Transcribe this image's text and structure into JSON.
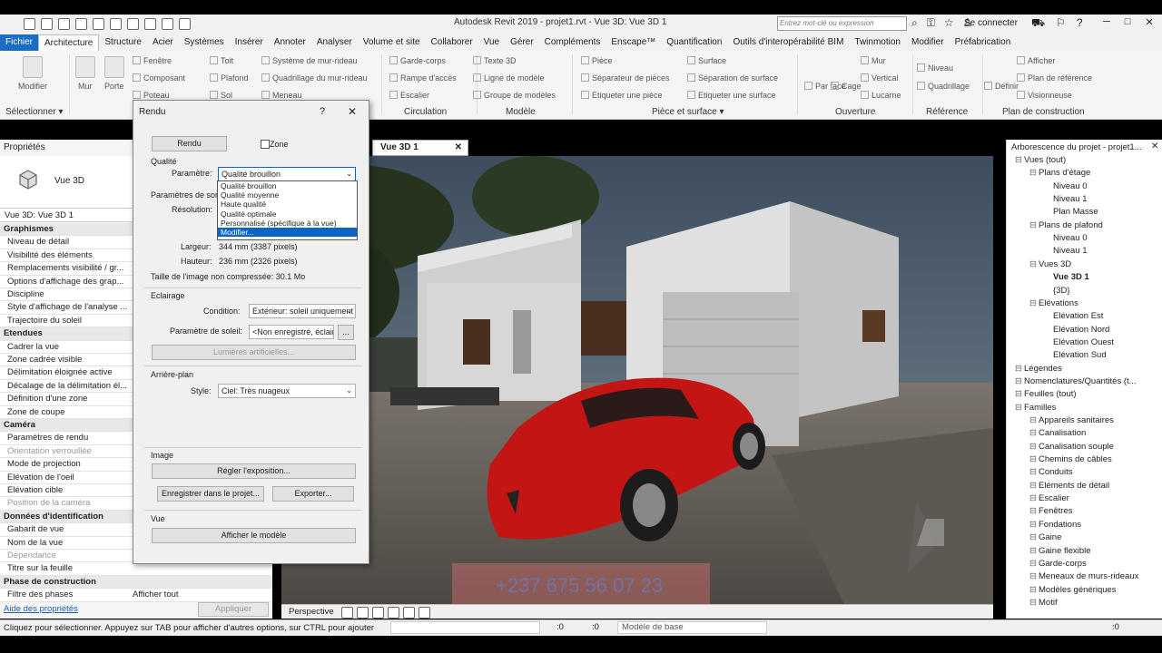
{
  "app": {
    "title": "Autodesk Revit 2019 - projet1.rvt - Vue 3D: Vue 3D 1",
    "search_placeholder": "Entrez mot-clé ou expression",
    "signin": "Se connecter",
    "logo": "R"
  },
  "menu": [
    "Fichier",
    "Architecture",
    "Structure",
    "Acier",
    "Systèmes",
    "Insérer",
    "Annoter",
    "Analyser",
    "Volume et site",
    "Collaborer",
    "Vue",
    "Gérer",
    "Compléments",
    "Enscape™",
    "Quantification",
    "Outils d'interopérabilité BIM",
    "Twinmotion",
    "Modifier",
    "Préfabrication"
  ],
  "ribbon": {
    "modify": "Modifier",
    "select": "Sélectionner",
    "mur": "Mur",
    "porte": "Porte",
    "build_small": [
      "Fenêtre",
      "Composant",
      "Poteau",
      "Toit",
      "Plafond",
      "Sol",
      "Système de mur-rideau",
      "Quadrillage du mur-rideau",
      "Meneau"
    ],
    "circ_small": [
      "Garde-corps",
      "Rampe d'accès",
      "Escalier"
    ],
    "circ_title": "Circulation",
    "model_small": [
      "Texte 3D",
      "Ligne de modèle",
      "Groupe de modèles"
    ],
    "model_title": "Modèle",
    "room_small": [
      "Pièce",
      "Séparateur de pièces",
      "Etiqueter une pièce",
      "Surface",
      "Séparation de surface",
      "Etiqueter une surface"
    ],
    "room_title": "Pièce et surface",
    "open_items": [
      "Par face",
      "Cage",
      "Mur",
      "Vertical",
      "Lucarne"
    ],
    "open_title": "Ouverture",
    "ref_items": [
      "Niveau",
      "Quadrillage"
    ],
    "ref_title": "Référence",
    "wp_items": [
      "Définir",
      "Afficher",
      "Plan de référence",
      "Visionneuse"
    ],
    "wp_title": "Plan de construction"
  },
  "properties": {
    "header": "Propriétés",
    "type": "Vue 3D",
    "instance": "Vue 3D: Vue 3D 1",
    "rows": [
      {
        "k": "Graphismes",
        "sec": true
      },
      {
        "k": "Niveau de détail"
      },
      {
        "k": "Visibilité des éléments"
      },
      {
        "k": "Remplacements visibilité / gr..."
      },
      {
        "k": "Options d'affichage des grap..."
      },
      {
        "k": "Discipline"
      },
      {
        "k": "Style d'affichage de l'analyse ..."
      },
      {
        "k": "Trajectoire du soleil"
      },
      {
        "k": "Etendues",
        "sec": true
      },
      {
        "k": "Cadrer la vue"
      },
      {
        "k": "Zone cadrée visible"
      },
      {
        "k": "Délimitation éloignée active"
      },
      {
        "k": "Décalage de la délimitation él..."
      },
      {
        "k": "Définition d'une zone"
      },
      {
        "k": "Zone de coupe"
      },
      {
        "k": "Caméra",
        "sec": true
      },
      {
        "k": "Paramètres de rendu"
      },
      {
        "k": "Orientation verrouillée",
        "dis": true
      },
      {
        "k": "Mode de projection"
      },
      {
        "k": "Elévation de l'oeil"
      },
      {
        "k": "Elévation cible"
      },
      {
        "k": "Position de la caméra",
        "dis": true
      },
      {
        "k": "Données d'identification",
        "sec": true
      },
      {
        "k": "Gabarit de vue"
      },
      {
        "k": "Nom de la vue"
      },
      {
        "k": "Dépendance",
        "dis": true
      },
      {
        "k": "Titre sur la feuille"
      },
      {
        "k": "Phase de construction",
        "sec": true
      },
      {
        "k": "Filtre des phases",
        "v": "Afficher tout"
      }
    ],
    "help": "Aide des propriétés",
    "apply": "Appliquer"
  },
  "dialog": {
    "title": "Rendu",
    "help": "?",
    "close": "✕",
    "render_btn": "Rendu",
    "zone": "Zone",
    "quality": "Qualité",
    "param": "Paramètre:",
    "param_value": "Qualité brouillon",
    "dropdown": [
      "Qualité brouillon",
      "Qualité moyenne",
      "Haute qualité",
      "Qualité optimale",
      "Personnalisé (spécifique à la vue)",
      "Modifier..."
    ],
    "output": "Paramètres de sortie",
    "resolution": "Résolution:",
    "width_lbl": "Largeur:",
    "width": "344 mm (3387 pixels)",
    "height_lbl": "Hauteur:",
    "height": "236 mm (2326 pixels)",
    "size": "Taille de l'image non compressée: 30.1 Mo",
    "lighting": "Eclairage",
    "condition_lbl": "Condition:",
    "condition": "Extérieur: soleil uniquement",
    "sun_lbl": "Paramètre de soleil:",
    "sun": "<Non enregistré, éclairage>",
    "sun_btn": "...",
    "artificial": "Lumières artificielles...",
    "bg": "Arrière-plan",
    "style_lbl": "Style:",
    "style": "Ciel: Très nuageux",
    "image": "Image",
    "exposure": "Régler l'exposition...",
    "save": "Enregistrer dans le projet...",
    "export": "Exporter...",
    "view": "Vue",
    "show_model": "Afficher le modèle"
  },
  "view": {
    "tab": "Vue 3D 1",
    "close": "✕",
    "projection": "Perspective",
    "watermark": "+237 675 56 07 23"
  },
  "tree": {
    "header": "Arborescence du projet - projet1...",
    "items": [
      {
        "t": "Vues (tout)",
        "l": 0
      },
      {
        "t": "Plans d'étage",
        "l": 1
      },
      {
        "t": "Niveau 0",
        "l": 2
      },
      {
        "t": "Niveau 1",
        "l": 2
      },
      {
        "t": "Plan Masse",
        "l": 2
      },
      {
        "t": "Plans de plafond",
        "l": 1
      },
      {
        "t": "Niveau 0",
        "l": 2
      },
      {
        "t": "Niveau 1",
        "l": 2
      },
      {
        "t": "Vues 3D",
        "l": 1
      },
      {
        "t": "Vue 3D 1",
        "l": 2,
        "b": true
      },
      {
        "t": "{3D}",
        "l": 2
      },
      {
        "t": "Elévations",
        "l": 1
      },
      {
        "t": "Elévation Est",
        "l": 2
      },
      {
        "t": "Elévation Nord",
        "l": 2
      },
      {
        "t": "Elévation Ouest",
        "l": 2
      },
      {
        "t": "Elévation Sud",
        "l": 2
      },
      {
        "t": "Légendes",
        "l": 0
      },
      {
        "t": "Nomenclatures/Quantités (t...",
        "l": 0
      },
      {
        "t": "Feuilles (tout)",
        "l": 0
      },
      {
        "t": "Familles",
        "l": 0
      },
      {
        "t": "Appareils sanitaires",
        "l": 1
      },
      {
        "t": "Canalisation",
        "l": 1
      },
      {
        "t": "Canalisation souple",
        "l": 1
      },
      {
        "t": "Chemins de câbles",
        "l": 1
      },
      {
        "t": "Conduits",
        "l": 1
      },
      {
        "t": "Eléments de détail",
        "l": 1
      },
      {
        "t": "Escalier",
        "l": 1
      },
      {
        "t": "Fenêtres",
        "l": 1
      },
      {
        "t": "Fondations",
        "l": 1
      },
      {
        "t": "Gaine",
        "l": 1
      },
      {
        "t": "Gaine flexible",
        "l": 1
      },
      {
        "t": "Garde-corps",
        "l": 1
      },
      {
        "t": "Meneaux de murs-rideaux",
        "l": 1
      },
      {
        "t": "Modèles génériques",
        "l": 1
      },
      {
        "t": "Motif",
        "l": 1
      }
    ]
  },
  "status": {
    "text": "Cliquez pour sélectionner. Appuyez sur TAB pour afficher d'autres options, sur CTRL pour ajouter",
    "zero1": ":0",
    "zero2": ":0",
    "model": "Modèle de base",
    "zero3": ":0"
  }
}
